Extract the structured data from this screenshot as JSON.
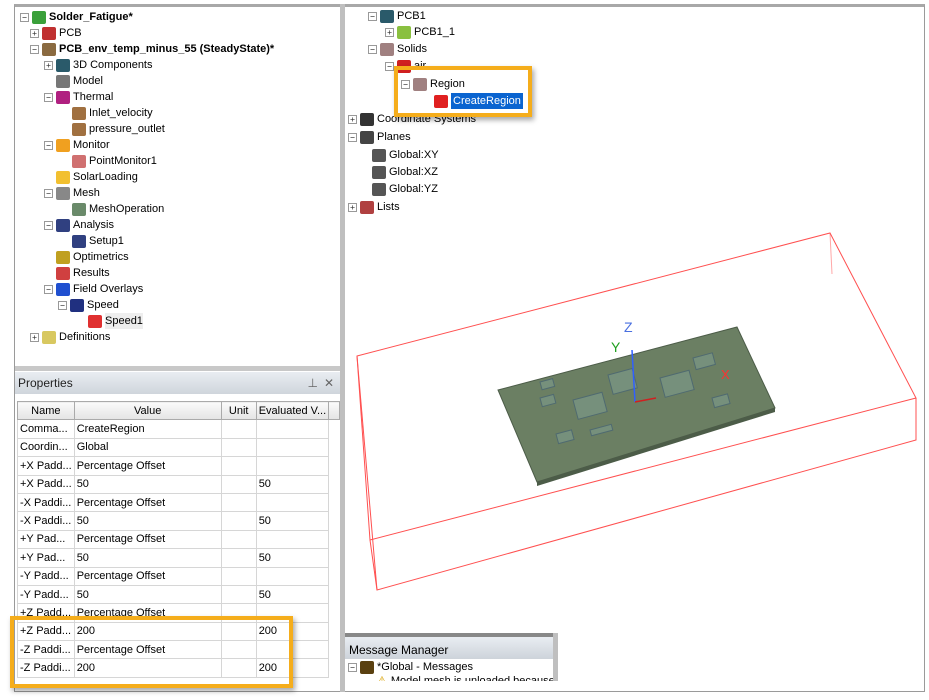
{
  "left_tree": {
    "items": [
      {
        "label": "Solder_Fatigue*",
        "bold": true,
        "icon": "project-icon",
        "color": "#3aa03a"
      },
      {
        "label": "PCB",
        "icon": "pcb-design-icon",
        "color": "#c03030"
      },
      {
        "label": "PCB_env_temp_minus_55 (SteadyState)*",
        "bold": true,
        "icon": "design-icon",
        "color": "#8a6a40"
      },
      {
        "label": "3D Components",
        "icon": "components-icon",
        "color": "#2a5a6a"
      },
      {
        "label": "Model",
        "icon": "model-icon",
        "color": "#777777"
      },
      {
        "label": "Thermal",
        "icon": "thermal-icon",
        "color": "#b02080"
      },
      {
        "label": "Inlet_velocity",
        "icon": "boundary-icon",
        "color": "#a07040"
      },
      {
        "label": "pressure_outlet",
        "icon": "boundary-icon",
        "color": "#a07040"
      },
      {
        "label": "Monitor",
        "icon": "monitor-icon",
        "color": "#f0a020"
      },
      {
        "label": "PointMonitor1",
        "icon": "point-monitor-icon",
        "color": "#d07070"
      },
      {
        "label": "SolarLoading",
        "icon": "sun-icon",
        "color": "#f2c030"
      },
      {
        "label": "Mesh",
        "icon": "mesh-icon",
        "color": "#888888"
      },
      {
        "label": "MeshOperation",
        "icon": "mesh-operation-icon",
        "color": "#6a8a6a"
      },
      {
        "label": "Analysis",
        "icon": "analysis-icon",
        "color": "#304080"
      },
      {
        "label": "Setup1",
        "icon": "setup-icon",
        "color": "#304080"
      },
      {
        "label": "Optimetrics",
        "icon": "optimetrics-icon",
        "color": "#c0a020"
      },
      {
        "label": "Results",
        "icon": "results-icon",
        "color": "#d04040"
      },
      {
        "label": "Field Overlays",
        "icon": "field-overlays-icon",
        "color": "#2050d0"
      },
      {
        "label": "Speed",
        "icon": "speed-icon",
        "color": "#203080"
      },
      {
        "label": "Speed1",
        "icon": "speed-plot-icon",
        "color": "#e03030"
      },
      {
        "label": "Definitions",
        "icon": "folder-icon",
        "color": "#d8c860"
      }
    ]
  },
  "right_tree": {
    "items": [
      {
        "label": "PCB1",
        "icon": "component-icon",
        "color": "#2a5a6a"
      },
      {
        "label": "PCB1_1",
        "icon": "pcb-body-icon",
        "color": "#8ac040"
      },
      {
        "label": "Solids",
        "icon": "solids-icon",
        "color": "#a08080"
      },
      {
        "label": "air",
        "icon": "material-icon",
        "color": "#d02020"
      },
      {
        "label": "Region",
        "icon": "region-icon",
        "color": "#a08080"
      },
      {
        "label": "CreateRegion",
        "icon": "create-region-icon",
        "color": "#e02020"
      },
      {
        "label": "Coordinate Systems",
        "icon": "coordinate-icon",
        "color": "#333333"
      },
      {
        "label": "Planes",
        "icon": "planes-icon",
        "color": "#444444"
      },
      {
        "label": "Global:XY",
        "icon": "plane-icon",
        "color": "#555555"
      },
      {
        "label": "Global:XZ",
        "icon": "plane-icon",
        "color": "#555555"
      },
      {
        "label": "Global:YZ",
        "icon": "plane-icon",
        "color": "#555555"
      },
      {
        "label": "Lists",
        "icon": "lists-icon",
        "color": "#b04040"
      }
    ]
  },
  "properties": {
    "title": "Properties",
    "columns": [
      "Name",
      "Value",
      "Unit",
      "Evaluated V..."
    ],
    "rows": [
      [
        "Comma...",
        "CreateRegion",
        "",
        ""
      ],
      [
        "Coordin...",
        "Global",
        "",
        ""
      ],
      [
        "+X Padd...",
        "Percentage Offset",
        "",
        ""
      ],
      [
        "+X Padd...",
        "50",
        "",
        "50"
      ],
      [
        "-X Paddi...",
        "Percentage Offset",
        "",
        ""
      ],
      [
        "-X Paddi...",
        "50",
        "",
        "50"
      ],
      [
        "+Y Pad...",
        "Percentage Offset",
        "",
        ""
      ],
      [
        "+Y Pad...",
        "50",
        "",
        "50"
      ],
      [
        "-Y Padd...",
        "Percentage Offset",
        "",
        ""
      ],
      [
        "-Y Padd...",
        "50",
        "",
        "50"
      ],
      [
        "+Z Padd...",
        "Percentage Offset",
        "",
        ""
      ],
      [
        "+Z Padd...",
        "200",
        "",
        "200"
      ],
      [
        "-Z Paddi...",
        "Percentage Offset",
        "",
        ""
      ],
      [
        "-Z Paddi...",
        "200",
        "",
        "200"
      ]
    ]
  },
  "viewport": {
    "axes": {
      "x": "X",
      "y": "Y",
      "z": "Z"
    },
    "region_color": "#ff4040",
    "pcb_color": "#6b7f63"
  },
  "message_manager": {
    "title": "Message Manager",
    "root": "*Global - Messages",
    "message": "Model mesh is unloaded because..."
  },
  "highlight_color": "#f5ad1b"
}
